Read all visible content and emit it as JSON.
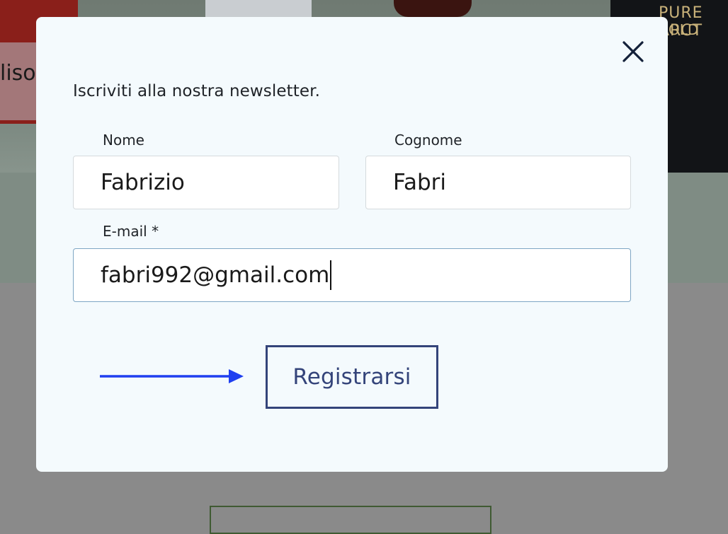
{
  "modal": {
    "title": "Iscriviti alla nostra newsletter.",
    "close_icon": "close-icon",
    "fields": {
      "first_name": {
        "label": "Nome",
        "value": "Fabrizio",
        "placeholder": ""
      },
      "last_name": {
        "label": "Cognome",
        "value": "Fabri",
        "placeholder": ""
      },
      "email": {
        "label": "E-mail *",
        "value": "fabri992@gmail.com",
        "placeholder": ""
      }
    },
    "submit_label": "Registrarsi",
    "arrow_icon": "arrow-right-icon"
  },
  "background": {
    "left_fragment": "lisot",
    "product_brand": "PURE ARCT",
    "product_line": "OLD"
  },
  "colors": {
    "modal_bg": "#f4fafd",
    "button_accent": "#34447a",
    "arrow": "#1f3ff0",
    "email_border": "#7ea6c4"
  }
}
